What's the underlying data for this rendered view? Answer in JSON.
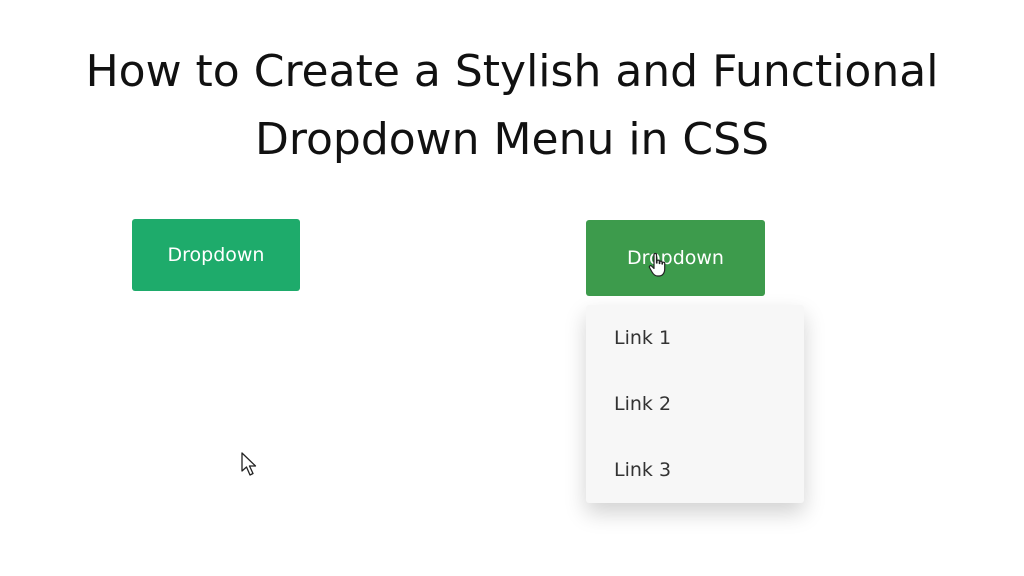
{
  "title": {
    "line1": "How to Create a Stylish and Functional",
    "line2": "Dropdown Menu in CSS"
  },
  "left_dropdown": {
    "button_label": "Dropdown",
    "color": "#1eab6b"
  },
  "right_dropdown": {
    "button_label": "Dropdown",
    "color": "#3d9b4c",
    "menu_items": [
      {
        "label": "Link 1"
      },
      {
        "label": "Link 2"
      },
      {
        "label": "Link 3"
      }
    ]
  },
  "cursors": {
    "left": "arrow-cursor-icon",
    "right": "hand-pointer-icon"
  }
}
